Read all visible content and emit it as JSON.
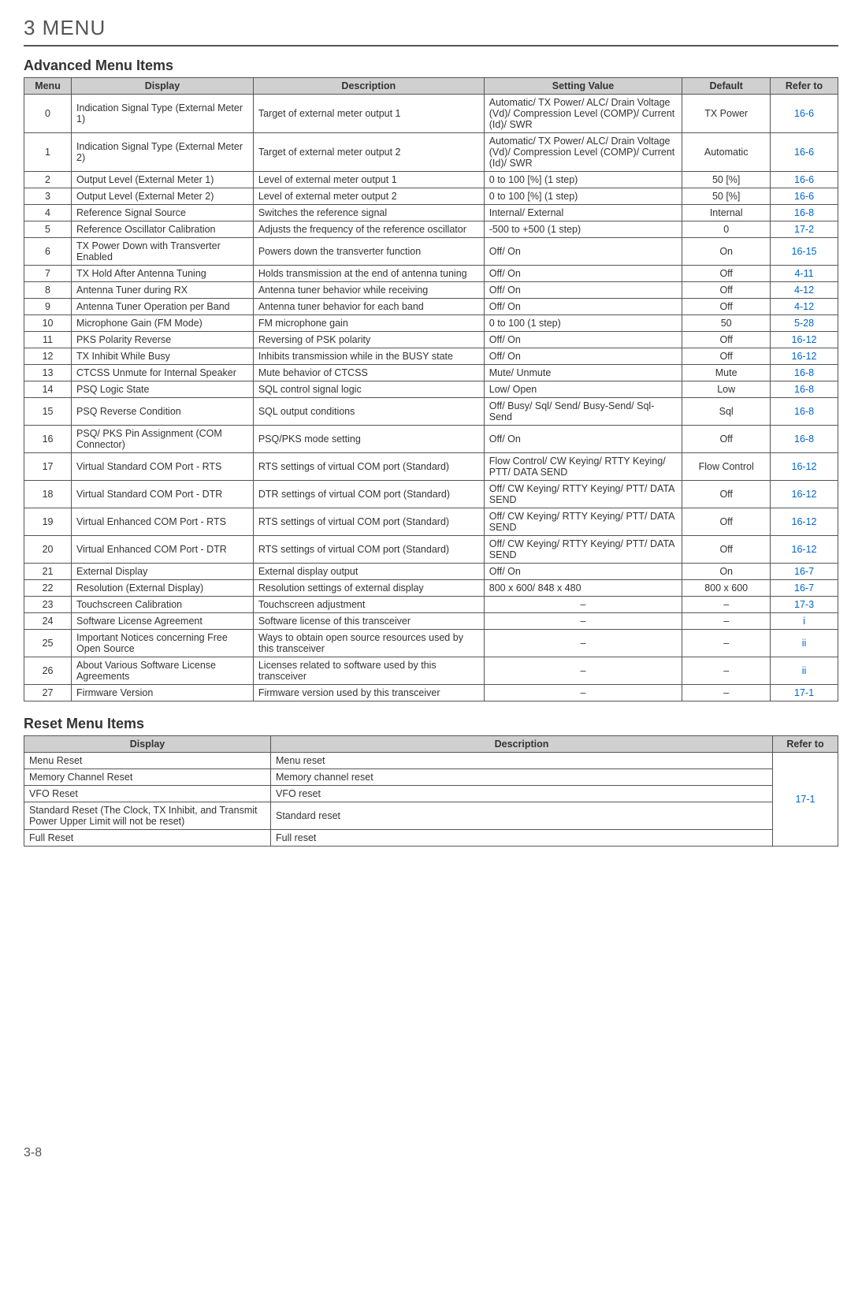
{
  "header": {
    "section": "3 MENU",
    "advanced_title": "Advanced Menu Items",
    "reset_title": "Reset Menu Items"
  },
  "adv_headers": {
    "menu": "Menu",
    "display": "Display",
    "description": "Description",
    "setting": "Setting Value",
    "default": "Default",
    "refer": "Refer to"
  },
  "reset_headers": {
    "display": "Display",
    "description": "Description",
    "refer": "Refer to"
  },
  "adv_rows": [
    {
      "menu": "0",
      "display": "Indication Signal Type (External Meter 1)",
      "desc": "Target of external meter output 1",
      "setting": "Automatic/ TX Power/ ALC/ Drain Voltage (Vd)/ Compression Level (COMP)/ Current (Id)/ SWR",
      "default": "TX Power",
      "refer": "16-6"
    },
    {
      "menu": "1",
      "display": "Indication Signal Type (External Meter 2)",
      "desc": "Target of external meter output 2",
      "setting": "Automatic/ TX Power/ ALC/ Drain Voltage (Vd)/ Compression Level (COMP)/ Current (Id)/ SWR",
      "default": "Automatic",
      "refer": "16-6"
    },
    {
      "menu": "2",
      "display": "Output Level (External Meter 1)",
      "desc": "Level of external meter output 1",
      "setting": "0 to 100 [%] (1 step)",
      "default": "50 [%]",
      "refer": "16-6"
    },
    {
      "menu": "3",
      "display": "Output Level (External Meter 2)",
      "desc": "Level of external meter output 2",
      "setting": "0 to 100 [%] (1 step)",
      "default": "50 [%]",
      "refer": "16-6"
    },
    {
      "menu": "4",
      "display": "Reference Signal Source",
      "desc": "Switches the reference signal",
      "setting": "Internal/ External",
      "default": "Internal",
      "refer": "16-8"
    },
    {
      "menu": "5",
      "display": "Reference Oscillator Calibration",
      "desc": "Adjusts the frequency of the reference oscillator",
      "setting": "-500 to +500 (1 step)",
      "default": "0",
      "refer": "17-2"
    },
    {
      "menu": "6",
      "display": "TX Power Down with Transverter Enabled",
      "desc": "Powers down the transverter function",
      "setting": "Off/ On",
      "default": "On",
      "refer": "16-15"
    },
    {
      "menu": "7",
      "display": "TX Hold After Antenna Tuning",
      "desc": "Holds transmission at the end of antenna tuning",
      "setting": "Off/ On",
      "default": "Off",
      "refer": "4-11"
    },
    {
      "menu": "8",
      "display": "Antenna Tuner during RX",
      "desc": "Antenna tuner behavior while receiving",
      "setting": "Off/ On",
      "default": "Off",
      "refer": "4-12"
    },
    {
      "menu": "9",
      "display": "Antenna Tuner Operation per Band",
      "desc": "Antenna tuner behavior for each band",
      "setting": "Off/ On",
      "default": "Off",
      "refer": "4-12"
    },
    {
      "menu": "10",
      "display": "Microphone Gain (FM Mode)",
      "desc": "FM microphone gain",
      "setting": "0 to 100 (1 step)",
      "default": "50",
      "refer": "5-28"
    },
    {
      "menu": "11",
      "display": "PKS Polarity Reverse",
      "desc": "Reversing of PSK polarity",
      "setting": "Off/ On",
      "default": "Off",
      "refer": "16-12"
    },
    {
      "menu": "12",
      "display": "TX Inhibit While Busy",
      "desc": "Inhibits transmission while in the BUSY state",
      "setting": "Off/ On",
      "default": "Off",
      "refer": "16-12"
    },
    {
      "menu": "13",
      "display": "CTCSS Unmute for Internal Speaker",
      "desc": "Mute behavior of CTCSS",
      "setting": "Mute/ Unmute",
      "default": "Mute",
      "refer": "16-8"
    },
    {
      "menu": "14",
      "display": "PSQ Logic State",
      "desc": "SQL control signal logic",
      "setting": "Low/ Open",
      "default": "Low",
      "refer": "16-8"
    },
    {
      "menu": "15",
      "display": "PSQ Reverse Condition",
      "desc": "SQL output conditions",
      "setting": "Off/ Busy/ Sql/ Send/ Busy-Send/ Sql-Send",
      "default": "Sql",
      "refer": "16-8"
    },
    {
      "menu": "16",
      "display": "PSQ/ PKS Pin Assignment (COM Connector)",
      "desc": "PSQ/PKS mode setting",
      "setting": "Off/ On",
      "default": "Off",
      "refer": "16-8"
    },
    {
      "menu": "17",
      "display": "Virtual Standard COM Port - RTS",
      "desc": "RTS settings of virtual COM port (Standard)",
      "setting": "Flow Control/ CW Keying/ RTTY Keying/ PTT/ DATA SEND",
      "default": "Flow Control",
      "refer": "16-12"
    },
    {
      "menu": "18",
      "display": "Virtual Standard COM Port - DTR",
      "desc": "DTR settings of virtual COM port (Standard)",
      "setting": "Off/ CW Keying/ RTTY Keying/ PTT/ DATA SEND",
      "default": "Off",
      "refer": "16-12"
    },
    {
      "menu": "19",
      "display": "Virtual Enhanced COM Port - RTS",
      "desc": "RTS settings of virtual COM port (Standard)",
      "setting": "Off/ CW Keying/ RTTY Keying/ PTT/ DATA SEND",
      "default": "Off",
      "refer": "16-12"
    },
    {
      "menu": "20",
      "display": "Virtual Enhanced COM Port - DTR",
      "desc": "RTS settings of virtual COM port (Standard)",
      "setting": "Off/ CW Keying/ RTTY Keying/ PTT/ DATA SEND",
      "default": "Off",
      "refer": "16-12"
    },
    {
      "menu": "21",
      "display": "External Display",
      "desc": "External display output",
      "setting": "Off/ On",
      "default": "On",
      "refer": "16-7"
    },
    {
      "menu": "22",
      "display": "Resolution (External Display)",
      "desc": "Resolution settings of external display",
      "setting": "800 x 600/ 848 x 480",
      "default": "800 x 600",
      "refer": "16-7"
    },
    {
      "menu": "23",
      "display": "Touchscreen Calibration",
      "desc": "Touchscreen adjustment",
      "setting": "–",
      "default": "–",
      "refer": "17-3"
    },
    {
      "menu": "24",
      "display": "Software License Agreement",
      "desc": "Software license of this transceiver",
      "setting": "–",
      "default": "–",
      "refer": "i"
    },
    {
      "menu": "25",
      "display": "Important Notices concerning Free Open Source",
      "desc": "Ways to obtain open source resources used by this transceiver",
      "setting": "–",
      "default": "–",
      "refer": "ii"
    },
    {
      "menu": "26",
      "display": "About Various Software License Agreements",
      "desc": "Licenses related to software used by this transceiver",
      "setting": "–",
      "default": "–",
      "refer": "ii"
    },
    {
      "menu": "27",
      "display": "Firmware Version",
      "desc": "Firmware version used by this transceiver",
      "setting": "–",
      "default": "–",
      "refer": "17-1"
    }
  ],
  "reset_rows": [
    {
      "display": "Menu Reset",
      "desc": "Menu reset"
    },
    {
      "display": "Memory Channel Reset",
      "desc": "Memory channel reset"
    },
    {
      "display": "VFO Reset",
      "desc": "VFO reset"
    },
    {
      "display": "Standard Reset (The Clock, TX Inhibit, and Transmit Power Upper Limit will not be reset)",
      "desc": "Standard reset"
    },
    {
      "display": "Full Reset",
      "desc": "Full reset"
    }
  ],
  "reset_refer": "17-1",
  "footer": "3-8"
}
